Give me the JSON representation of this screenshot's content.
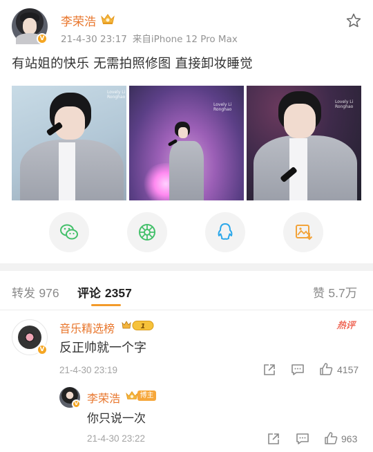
{
  "post": {
    "author": "李荣浩",
    "date": "21-4-30 23:17",
    "source": "来自iPhone 12 Pro Max",
    "text": "有站姐的快乐 无需拍照修图 直接卸妆睡觉",
    "photo_watermark": "Lovely Li Ronghao"
  },
  "share": {
    "icons": [
      "wechat-icon",
      "moments-icon",
      "qq-icon",
      "save-image-icon"
    ]
  },
  "tabs": {
    "repost_label": "转发",
    "repost_count": "976",
    "comment_label": "评论",
    "comment_count": "2357",
    "like_label": "赞",
    "like_count": "5.7万"
  },
  "comments": [
    {
      "author": "音乐精选榜",
      "level": "1",
      "tag": "热评",
      "text": "反正帅就一个字",
      "date": "21-4-30 23:19",
      "likes": "4157",
      "reply": {
        "author": "李荣浩",
        "badge": "博主",
        "text": "你只说一次",
        "date": "21-4-30 23:22",
        "likes": "963"
      }
    }
  ],
  "colors": {
    "accent_orange": "#e8762c",
    "tab_underline": "#f39a2a",
    "hot_red": "#ef6a5a",
    "vip_gold": "#f5a623"
  }
}
